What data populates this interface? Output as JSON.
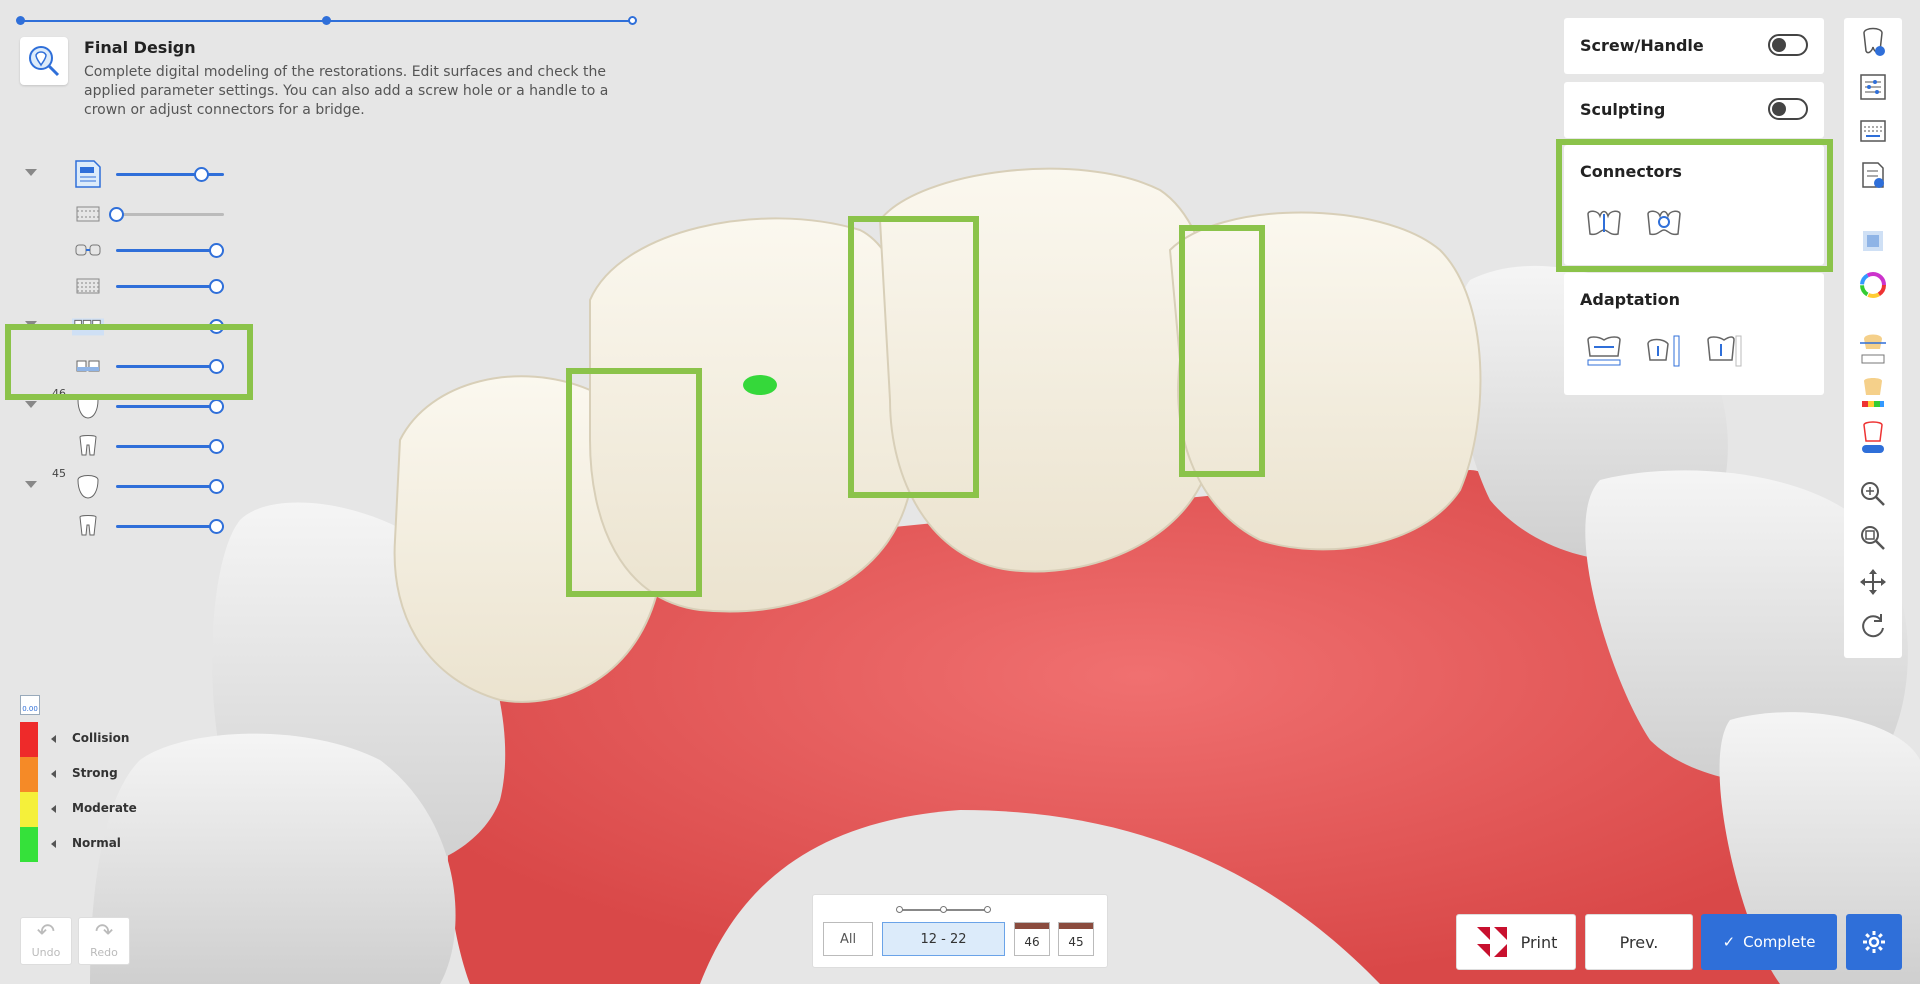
{
  "stage": {
    "title": "Final Design",
    "description": "Complete digital modeling of the restorations. Edit surfaces and check the applied parameter settings. You can also add a screw hole or a handle to a crown or adjust connectors for a bridge.",
    "progress_dots": 3
  },
  "tree": [
    {
      "caret": true,
      "icon": "document-icon",
      "level": 0.85
    },
    {
      "caret": false,
      "icon": "scan-jaw-icon",
      "level": 0.0
    },
    {
      "caret": false,
      "icon": "bridge-outline-icon",
      "level": 1.0
    },
    {
      "caret": false,
      "icon": "jaw-scan-icon",
      "level": 1.0
    },
    {
      "caret": true,
      "icon": "bridge-icon",
      "level": 1.0
    },
    {
      "caret": false,
      "icon": "bridge-small-icon",
      "level": 1.0
    },
    {
      "caret": true,
      "icon": "crown-icon",
      "number": "46",
      "level": 1.0
    },
    {
      "caret": false,
      "icon": "abutment-icon",
      "level": 1.0
    },
    {
      "caret": true,
      "icon": "crown-icon",
      "number": "45",
      "level": 1.0
    },
    {
      "caret": false,
      "icon": "abutment-icon",
      "level": 1.0
    }
  ],
  "legend": {
    "value": "0.00",
    "items": [
      {
        "label": "Collision",
        "color": "#ee2a2a"
      },
      {
        "label": "Strong",
        "color": "#f58a27"
      },
      {
        "label": "Moderate",
        "color": "#f5f03a"
      },
      {
        "label": "Normal",
        "color": "#35e13a"
      }
    ]
  },
  "undo": {
    "label": "Undo"
  },
  "redo": {
    "label": "Redo"
  },
  "bottom": {
    "all_label": "All",
    "range_label": "12 - 22",
    "tooth_46": "46",
    "tooth_45": "45"
  },
  "panel": {
    "screw_handle": {
      "label": "Screw/Handle",
      "on": false
    },
    "sculpting": {
      "label": "Sculpting",
      "on": false
    },
    "connectors": {
      "label": "Connectors"
    },
    "adaptation": {
      "label": "Adaptation"
    }
  },
  "buttons": {
    "print": "Print",
    "prev": "Prev.",
    "complete": "Complete"
  },
  "colors": {
    "accent": "#2f6fd9",
    "highlight": "#8bc34a",
    "gum": "#e85a5a",
    "tooth": "#f3ede0",
    "complete_bg": "#2f6fd9"
  }
}
